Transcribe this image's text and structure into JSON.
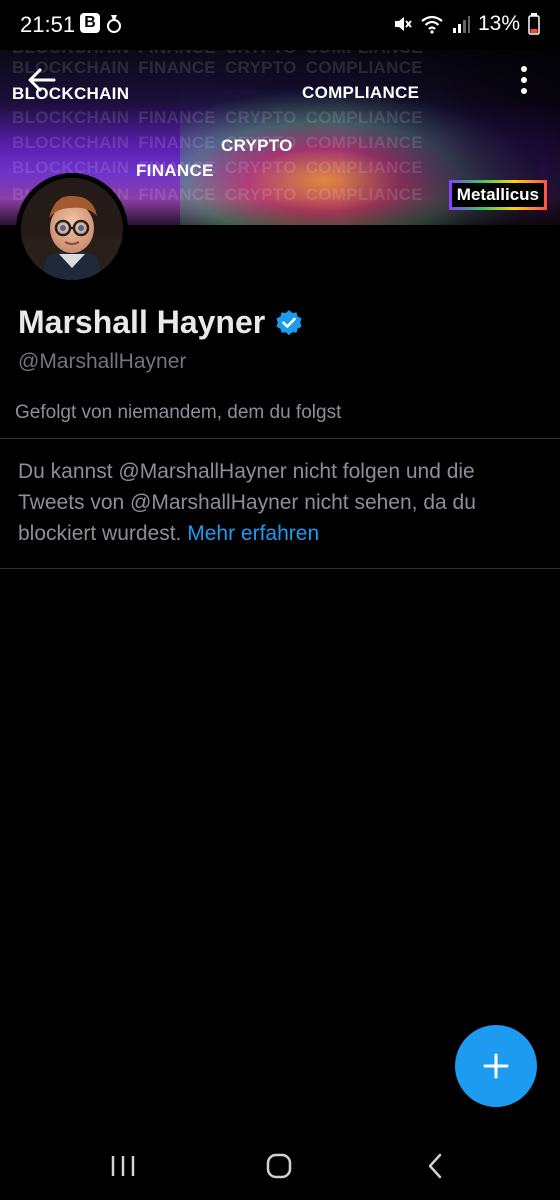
{
  "status_bar": {
    "time": "21:51",
    "app_icon_1": "B",
    "battery": "13%",
    "icons": [
      "mute-icon",
      "wifi-icon",
      "signal-icon",
      "battery-icon"
    ]
  },
  "banner": {
    "words": [
      "BLOCKCHAIN",
      "FINANCE",
      "CRYPTO",
      "COMPLIANCE"
    ],
    "highlighted": {
      "blockchain": "BLOCKCHAIN",
      "compliance": "COMPLIANCE",
      "crypto": "CRYPTO",
      "finance": "FINANCE"
    },
    "brand": "Metallicus"
  },
  "profile": {
    "name": "Marshall Hayner",
    "handle": "@MarshallHayner",
    "followed_by": "Gefolgt von niemandem, dem du folgst",
    "verified": true
  },
  "blocked_notice": {
    "text": "Du kannst @MarshallHayner nicht folgen und die Tweets von @MarshallHayner nicht sehen, da du blockiert wurdest.",
    "link": "Mehr erfahren"
  },
  "colors": {
    "accent": "#1d9bf0",
    "background": "#000000",
    "muted_text": "#71767b"
  }
}
